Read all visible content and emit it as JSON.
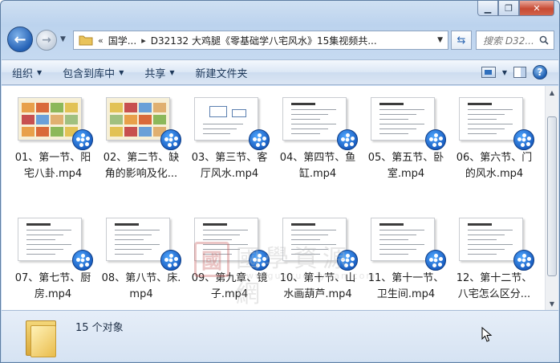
{
  "window": {
    "caption_buttons": [
      "minimize",
      "restore",
      "close"
    ]
  },
  "nav": {
    "back_icon": "back-arrow-icon",
    "forward_icon": "forward-arrow-icon",
    "address_prefix": "«",
    "crumbs": [
      "国学...",
      "D32132 大鸡腿《零基础学八宅风水》15集视频共..."
    ],
    "search_placeholder": "搜索 D32..."
  },
  "toolbar": {
    "organize": "组织",
    "include_library": "包含到库中",
    "share": "共享",
    "new_folder": "新建文件夹"
  },
  "files": [
    {
      "name": "01、第一节、阳宅八卦.mp4",
      "line1": "01、第一节、阳",
      "line2": "宅八卦.mp4",
      "thumb": "photo"
    },
    {
      "name": "02、第二节、缺角的影响及化...",
      "line1": "02、第二节、缺",
      "line2": "角的影响及化...",
      "thumb": "photo2"
    },
    {
      "name": "03、第三节、客厅风水.mp4",
      "line1": "03、第三节、客",
      "line2": "厅风水.mp4",
      "thumb": "diagram"
    },
    {
      "name": "04、第四节、鱼缸.mp4",
      "line1": "04、第四节、鱼",
      "line2": "缸.mp4",
      "thumb": "text"
    },
    {
      "name": "05、第五节、卧室.mp4",
      "line1": "05、第五节、卧",
      "line2": "室.mp4",
      "thumb": "text"
    },
    {
      "name": "06、第六节、门的风水.mp4",
      "line1": "06、第六节、门",
      "line2": "的风水.mp4",
      "thumb": "text"
    },
    {
      "name": "07、第七节、厨房.mp4",
      "line1": "07、第七节、厨",
      "line2": "房.mp4",
      "thumb": "text"
    },
    {
      "name": "08、第八节、床.mp4",
      "line1": "08、第八节、床.",
      "line2": "mp4",
      "thumb": "text"
    },
    {
      "name": "09、第九章、镜子.mp4",
      "line1": "09、第九章、镜",
      "line2": "子.mp4",
      "thumb": "text"
    },
    {
      "name": "10、第十节、山水画葫芦.mp4",
      "line1": "10、第十节、山",
      "line2": "水画葫芦.mp4",
      "thumb": "text"
    },
    {
      "name": "11、第十一节、卫生间.mp4",
      "line1": "11、第十一节、",
      "line2": "卫生间.mp4",
      "thumb": "text"
    },
    {
      "name": "12、第十二节、八宅怎么区分...",
      "line1": "12、第十二节、",
      "line2": "八宅怎么区分...",
      "thumb": "text"
    }
  ],
  "watermark": {
    "seal": "國",
    "text": "國學資源網",
    "url": "www.guoxueziyuan.com"
  },
  "details": {
    "count_text": "15 个对象"
  },
  "colors": {
    "accent": "#2461b5",
    "badge": "#1a5fc2"
  }
}
